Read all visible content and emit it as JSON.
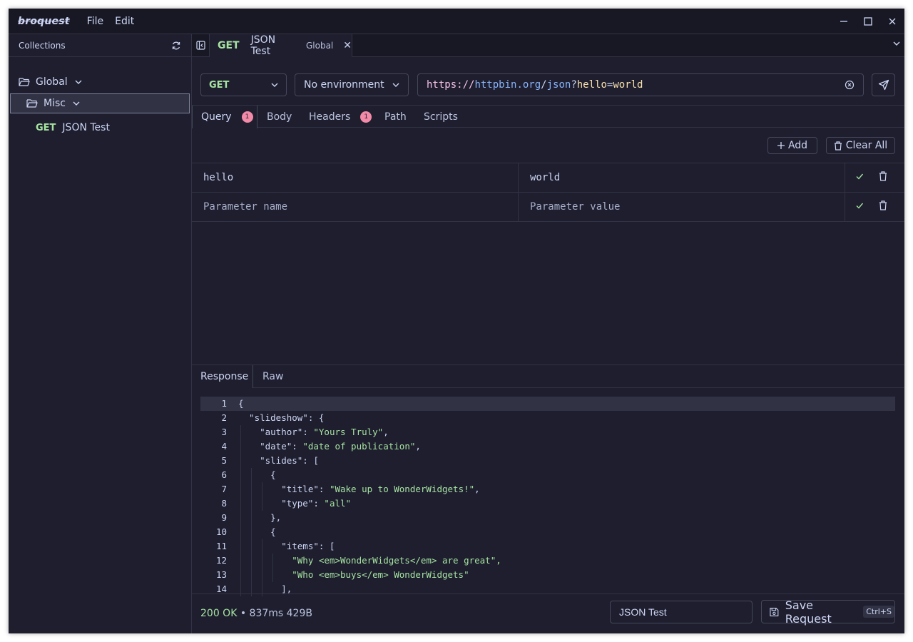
{
  "app": {
    "logo": "broquest",
    "menu": [
      "File",
      "Edit"
    ]
  },
  "sidebar": {
    "header": "Collections",
    "tree": {
      "global_label": "Global",
      "misc_label": "Misc",
      "request_method": "GET",
      "request_name": "JSON Test"
    }
  },
  "tab": {
    "method": "GET",
    "name": "JSON Test",
    "env": "Global",
    "close": "✕"
  },
  "request": {
    "method": "GET",
    "environment": "No environment",
    "url": {
      "proto": "https://",
      "host": "httpbin.org",
      "slash": "/",
      "path": "json",
      "q": "?",
      "key": "hello",
      "eq": "=",
      "value": "world"
    }
  },
  "req_tabs": {
    "query": "Query",
    "query_badge": "1",
    "body": "Body",
    "headers": "Headers",
    "headers_badge": "1",
    "path": "Path",
    "scripts": "Scripts"
  },
  "params": {
    "add_label": "Add",
    "clear_label": "Clear All",
    "rows": [
      {
        "key": "hello",
        "value": "world"
      }
    ],
    "placeholder_key": "Parameter name",
    "placeholder_value": "Parameter value"
  },
  "response": {
    "tab_response": "Response",
    "tab_raw": "Raw",
    "line_numbers": [
      "1",
      "2",
      "3",
      "4",
      "5",
      "6",
      "7",
      "8",
      "9",
      "10",
      "11",
      "12",
      "13",
      "14"
    ],
    "lines": [
      "{",
      "  \"slideshow\": {",
      "    \"author\": \"Yours Truly\",",
      "    \"date\": \"date of publication\",",
      "    \"slides\": [",
      "      {",
      "        \"title\": \"Wake up to WonderWidgets!\",",
      "        \"type\": \"all\"",
      "      },",
      "      {",
      "        \"items\": [",
      "          \"Why <em>WonderWidgets</em> are great\",",
      "          \"Who <em>buys</em> WonderWidgets\"",
      "        ],"
    ],
    "status": "200 OK",
    "meta": " • 837ms 429B"
  },
  "footer": {
    "request_name": "JSON Test",
    "save_label": "Save Request",
    "shortcut": "Ctrl+S"
  }
}
